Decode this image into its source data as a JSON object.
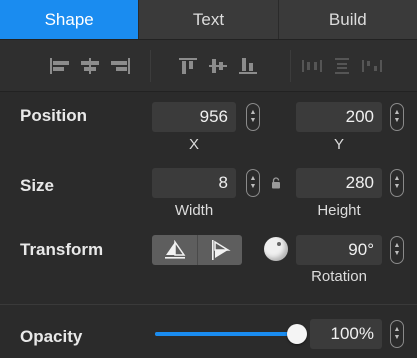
{
  "tabs": [
    {
      "label": "Shape",
      "active": true
    },
    {
      "label": "Text",
      "active": false
    },
    {
      "label": "Build",
      "active": false
    }
  ],
  "align_tools": {
    "horizontal": [
      "align-left-icon",
      "align-center-horizontal-icon",
      "align-right-icon"
    ],
    "vertical": [
      "align-top-icon",
      "align-middle-vertical-icon",
      "align-bottom-icon"
    ],
    "distribute": [
      "distribute-horizontal-icon",
      "distribute-vertical-icon",
      "distribute-spacing-icon"
    ]
  },
  "position": {
    "label": "Position",
    "x_value": "956",
    "x_label": "X",
    "y_value": "200",
    "y_label": "Y"
  },
  "size": {
    "label": "Size",
    "width_value": "8",
    "width_label": "Width",
    "height_value": "280",
    "height_label": "Height",
    "lock_icon": "lock-icon"
  },
  "transform": {
    "label": "Transform",
    "flip_icons": [
      "flip-horizontal-icon",
      "flip-vertical-icon"
    ],
    "rotation_value": "90°",
    "rotation_label": "Rotation"
  },
  "opacity": {
    "label": "Opacity",
    "value": "100%",
    "fraction": 1.0
  },
  "colors": {
    "accent": "#1a8cf0",
    "panel": "#2b2b2b",
    "field": "#3b3b3b"
  }
}
